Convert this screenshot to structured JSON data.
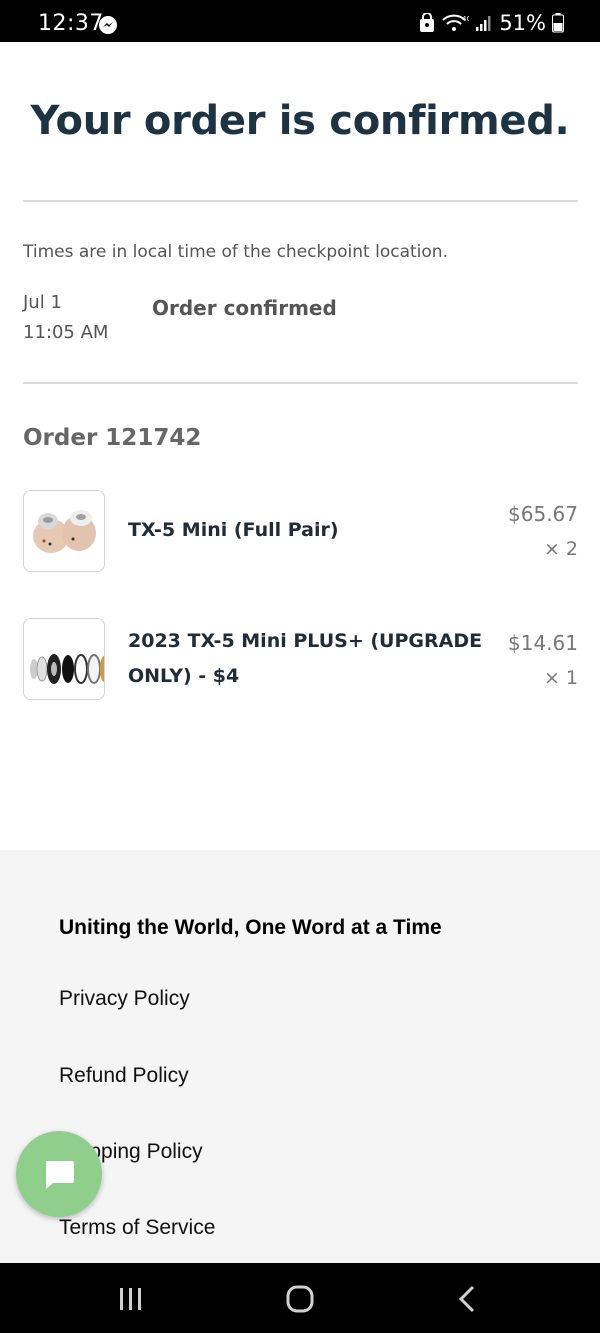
{
  "status_bar": {
    "time": "12:37",
    "battery": "51%"
  },
  "page": {
    "title": "Your order is confirmed."
  },
  "tracking": {
    "timezone_note": "Times are in local time of the checkpoint location.",
    "events": [
      {
        "date": "Jul 1",
        "time": "11:05 AM",
        "status": "Order confirmed"
      }
    ]
  },
  "order": {
    "title": "Order 121742",
    "items": [
      {
        "name": "TX-5 Mini (Full Pair)",
        "price": "$65.67",
        "qty": "× 2"
      },
      {
        "name_line1": "2023 TX-5 Mini PLUS+ (UPGRADE",
        "name_line2": "ONLY) - $4",
        "price": "$14.61",
        "qty": "× 1"
      }
    ]
  },
  "footer": {
    "tagline": "Uniting the World, One Word at a Time",
    "links": [
      "Privacy Policy",
      "Refund Policy",
      "Shipping Policy",
      "Terms of Service"
    ]
  },
  "colors": {
    "title": "#1e3342",
    "chat_button": "#8fcf8b",
    "footer_bg": "#f5f5f5"
  },
  "icons": {
    "status_left": "messenger-icon",
    "status_right": [
      "notification-lock-icon",
      "wifi-icon",
      "lte-icon",
      "signal-icon",
      "battery-icon"
    ],
    "chat": "chat-bubble-icon",
    "nav": [
      "recent-apps-icon",
      "home-icon",
      "back-icon"
    ]
  }
}
